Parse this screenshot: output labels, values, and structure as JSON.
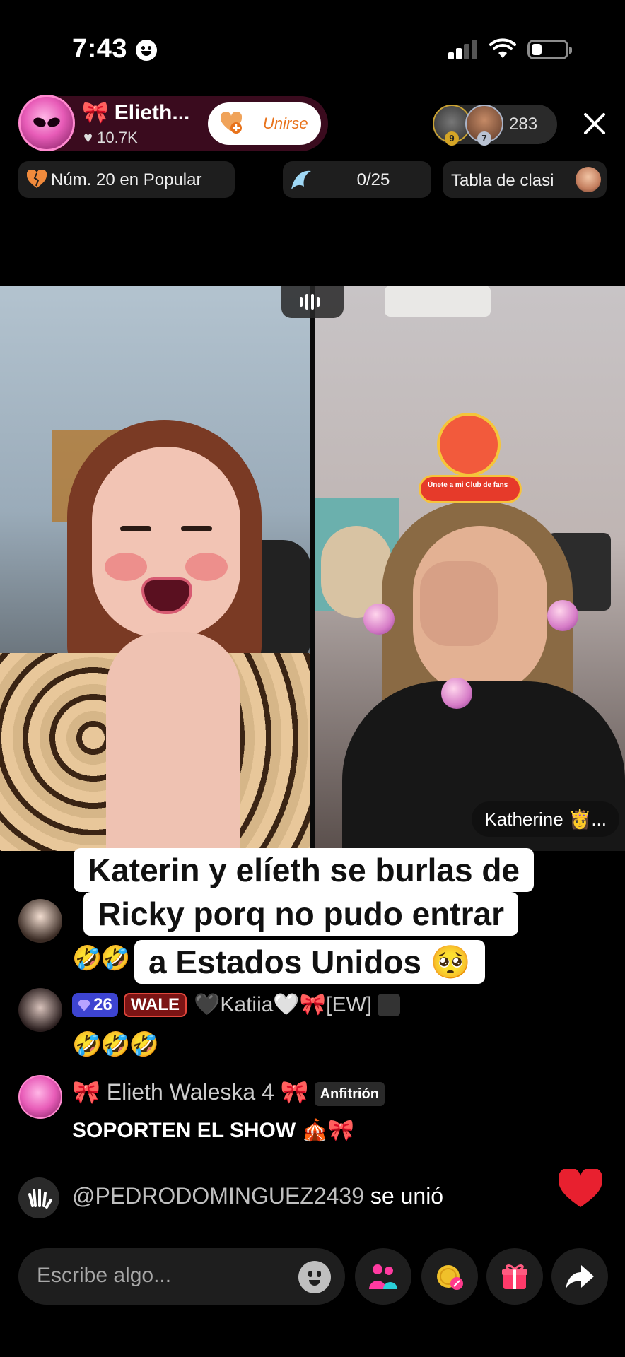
{
  "status_bar": {
    "time": "7:43"
  },
  "header": {
    "host_name": "🎀 Elieth...",
    "host_likes": "♥ 10.7K",
    "join_label": "Unirse",
    "viewer_ranks": [
      "9",
      "7"
    ],
    "viewer_count": "283"
  },
  "chips": {
    "rank_label": "Núm. 20 en Popular",
    "goal_label": "0/25",
    "leaderboard_label": "Tabla de clasi"
  },
  "video": {
    "sticker_label": "Únete a mi Club de fans",
    "guest_name": "Katherine 👸..."
  },
  "caption": {
    "line1": "Katerin y elíeth se burlas de",
    "line2": "Ricky porq no pudo entrar",
    "line3": "a Estados Unidos 🥺"
  },
  "chat": {
    "msg1_text": "🤣🤣",
    "msg2_level": "26",
    "msg2_fan_badge": "WALE",
    "msg2_user": "🖤Katiia🤍🎀[EW]",
    "msg2_text": "🤣🤣🤣",
    "host_user": "🎀 Elieth Waleska 4 🎀",
    "host_badge": "Anfitrión",
    "host_msg": "SOPORTEN EL SHOW 🎪🎀",
    "join_user": "@PEDRODOMINGUEZ2439",
    "join_text": " se unió"
  },
  "bottom_bar": {
    "input_placeholder": "Escribe algo..."
  },
  "colors": {
    "accent_orange": "#e8731c",
    "like_red": "#e8202f",
    "pill_dark": "#1e1e1e"
  },
  "icons": [
    "smiley-icon",
    "signal-icon",
    "wifi-icon",
    "battery-icon",
    "heart-plus-icon",
    "close-icon",
    "broken-heart-icon",
    "dolphin-goal-icon",
    "emoji-icon",
    "guests-icon",
    "discount-coin-icon",
    "gift-icon",
    "share-icon",
    "wave-hand-icon",
    "like-heart-icon"
  ]
}
